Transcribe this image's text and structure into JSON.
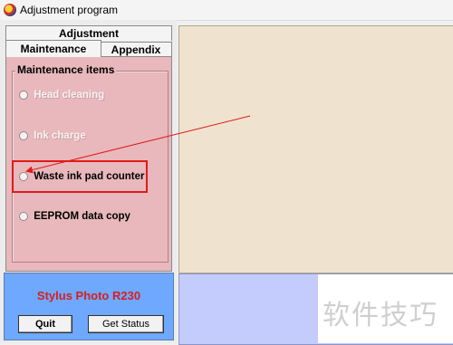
{
  "window": {
    "title": "Adjustment program",
    "icon": "app-icon"
  },
  "tabs": {
    "top": "Adjustment",
    "items": [
      {
        "label": "Maintenance",
        "selected": true
      },
      {
        "label": "Appendix",
        "selected": false
      }
    ]
  },
  "maintenance": {
    "group_title": "Maintenance items",
    "options": [
      {
        "label": "Head cleaning",
        "enabled": false
      },
      {
        "label": "Ink charge",
        "enabled": false
      },
      {
        "label": "Waste ink pad counter",
        "enabled": true,
        "highlighted": true
      },
      {
        "label": "EEPROM data copy",
        "enabled": true
      }
    ]
  },
  "footer": {
    "model": "Stylus Photo R230",
    "quit_label": "Quit",
    "status_label": "Get Status"
  },
  "watermark": "软件技巧",
  "colors": {
    "pink_panel": "#e8b8bc",
    "blue_panel": "#6ea8ff",
    "model_text": "#d81f1f",
    "beige_panel": "#efe3cf",
    "lavender_panel": "#c3ccfc",
    "annotation": "#e01b1b"
  }
}
